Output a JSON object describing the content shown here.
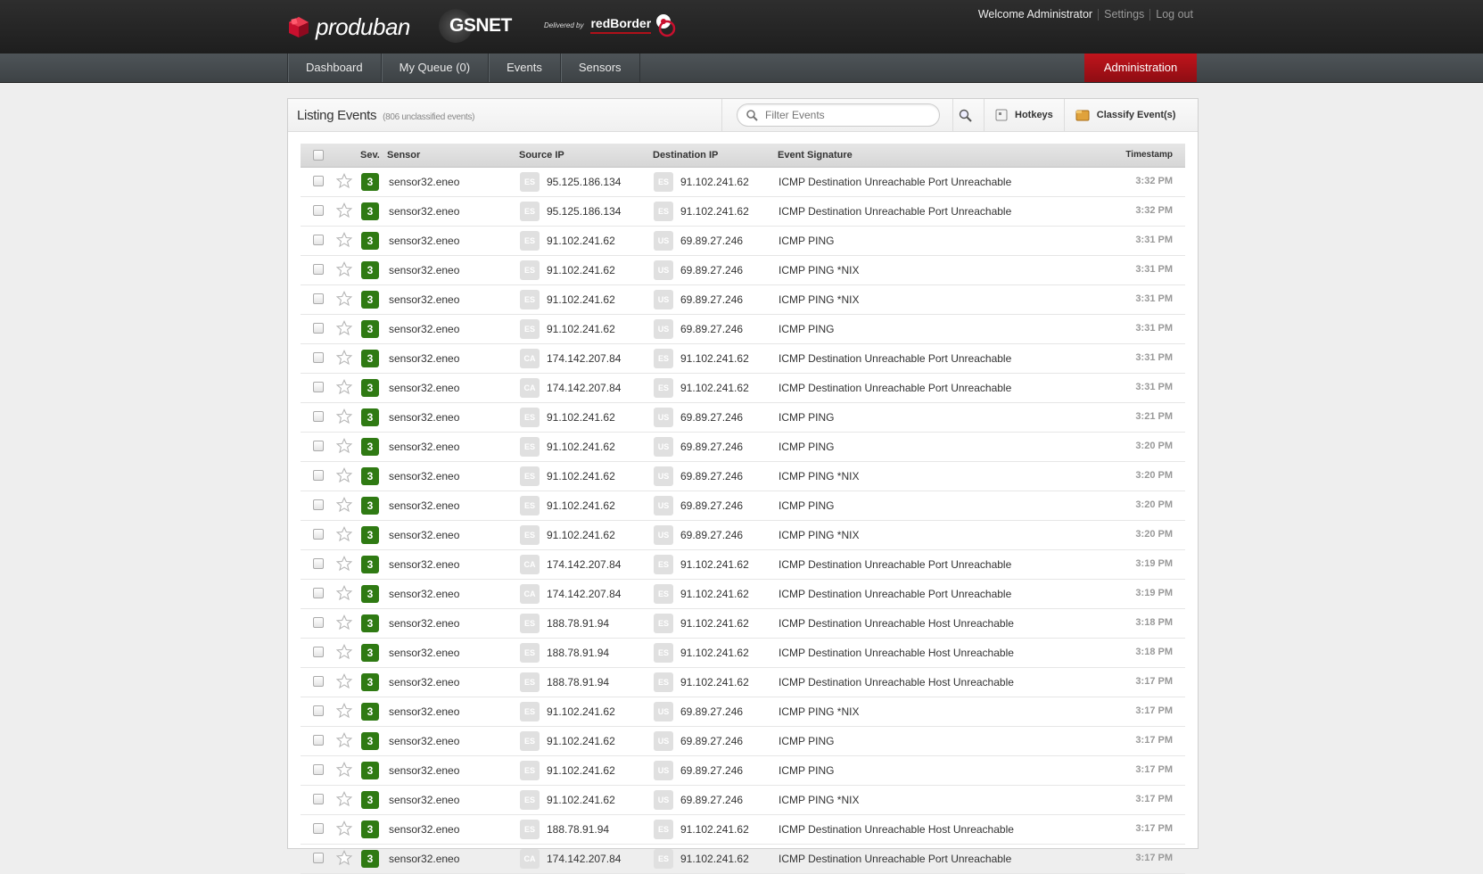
{
  "header": {
    "brand": "produban",
    "brand2": "GSNET",
    "delivered_by": "Delivered by",
    "redborder": "redBorder",
    "welcome": "Welcome Administrator",
    "settings": "Settings",
    "logout": "Log out"
  },
  "nav": {
    "tabs": [
      {
        "label": "Dashboard"
      },
      {
        "label": "My Queue (0)"
      },
      {
        "label": "Events"
      },
      {
        "label": "Sensors"
      }
    ],
    "admin": "Administration"
  },
  "panel": {
    "title": "Listing Events",
    "subtitle": "(806 unclassified events)",
    "filter_placeholder": "Filter Events",
    "hotkeys": "Hotkeys",
    "classify": "Classify Event(s)"
  },
  "columns": {
    "sev": "Sev.",
    "sensor": "Sensor",
    "source_ip": "Source IP",
    "destination_ip": "Destination IP",
    "signature": "Event Signature",
    "timestamp": "Timestamp"
  },
  "events": [
    {
      "sev": "3",
      "sensor": "sensor32.eneo",
      "src_cc": "ES",
      "src": "95.125.186.134",
      "dst_cc": "ES",
      "dst": "91.102.241.62",
      "sig": "ICMP Destination Unreachable Port Unreachable",
      "ts": "3:32 PM"
    },
    {
      "sev": "3",
      "sensor": "sensor32.eneo",
      "src_cc": "ES",
      "src": "95.125.186.134",
      "dst_cc": "ES",
      "dst": "91.102.241.62",
      "sig": "ICMP Destination Unreachable Port Unreachable",
      "ts": "3:32 PM"
    },
    {
      "sev": "3",
      "sensor": "sensor32.eneo",
      "src_cc": "ES",
      "src": "91.102.241.62",
      "dst_cc": "US",
      "dst": "69.89.27.246",
      "sig": "ICMP PING",
      "ts": "3:31 PM"
    },
    {
      "sev": "3",
      "sensor": "sensor32.eneo",
      "src_cc": "ES",
      "src": "91.102.241.62",
      "dst_cc": "US",
      "dst": "69.89.27.246",
      "sig": "ICMP PING *NIX",
      "ts": "3:31 PM"
    },
    {
      "sev": "3",
      "sensor": "sensor32.eneo",
      "src_cc": "ES",
      "src": "91.102.241.62",
      "dst_cc": "US",
      "dst": "69.89.27.246",
      "sig": "ICMP PING *NIX",
      "ts": "3:31 PM"
    },
    {
      "sev": "3",
      "sensor": "sensor32.eneo",
      "src_cc": "ES",
      "src": "91.102.241.62",
      "dst_cc": "US",
      "dst": "69.89.27.246",
      "sig": "ICMP PING",
      "ts": "3:31 PM"
    },
    {
      "sev": "3",
      "sensor": "sensor32.eneo",
      "src_cc": "CA",
      "src": "174.142.207.84",
      "dst_cc": "ES",
      "dst": "91.102.241.62",
      "sig": "ICMP Destination Unreachable Port Unreachable",
      "ts": "3:31 PM"
    },
    {
      "sev": "3",
      "sensor": "sensor32.eneo",
      "src_cc": "CA",
      "src": "174.142.207.84",
      "dst_cc": "ES",
      "dst": "91.102.241.62",
      "sig": "ICMP Destination Unreachable Port Unreachable",
      "ts": "3:31 PM"
    },
    {
      "sev": "3",
      "sensor": "sensor32.eneo",
      "src_cc": "ES",
      "src": "91.102.241.62",
      "dst_cc": "US",
      "dst": "69.89.27.246",
      "sig": "ICMP PING",
      "ts": "3:21 PM"
    },
    {
      "sev": "3",
      "sensor": "sensor32.eneo",
      "src_cc": "ES",
      "src": "91.102.241.62",
      "dst_cc": "US",
      "dst": "69.89.27.246",
      "sig": "ICMP PING",
      "ts": "3:20 PM"
    },
    {
      "sev": "3",
      "sensor": "sensor32.eneo",
      "src_cc": "ES",
      "src": "91.102.241.62",
      "dst_cc": "US",
      "dst": "69.89.27.246",
      "sig": "ICMP PING *NIX",
      "ts": "3:20 PM"
    },
    {
      "sev": "3",
      "sensor": "sensor32.eneo",
      "src_cc": "ES",
      "src": "91.102.241.62",
      "dst_cc": "US",
      "dst": "69.89.27.246",
      "sig": "ICMP PING",
      "ts": "3:20 PM"
    },
    {
      "sev": "3",
      "sensor": "sensor32.eneo",
      "src_cc": "ES",
      "src": "91.102.241.62",
      "dst_cc": "US",
      "dst": "69.89.27.246",
      "sig": "ICMP PING *NIX",
      "ts": "3:20 PM"
    },
    {
      "sev": "3",
      "sensor": "sensor32.eneo",
      "src_cc": "CA",
      "src": "174.142.207.84",
      "dst_cc": "ES",
      "dst": "91.102.241.62",
      "sig": "ICMP Destination Unreachable Port Unreachable",
      "ts": "3:19 PM"
    },
    {
      "sev": "3",
      "sensor": "sensor32.eneo",
      "src_cc": "CA",
      "src": "174.142.207.84",
      "dst_cc": "ES",
      "dst": "91.102.241.62",
      "sig": "ICMP Destination Unreachable Port Unreachable",
      "ts": "3:19 PM"
    },
    {
      "sev": "3",
      "sensor": "sensor32.eneo",
      "src_cc": "ES",
      "src": "188.78.91.94",
      "dst_cc": "ES",
      "dst": "91.102.241.62",
      "sig": "ICMP Destination Unreachable Host Unreachable",
      "ts": "3:18 PM"
    },
    {
      "sev": "3",
      "sensor": "sensor32.eneo",
      "src_cc": "ES",
      "src": "188.78.91.94",
      "dst_cc": "ES",
      "dst": "91.102.241.62",
      "sig": "ICMP Destination Unreachable Host Unreachable",
      "ts": "3:18 PM"
    },
    {
      "sev": "3",
      "sensor": "sensor32.eneo",
      "src_cc": "ES",
      "src": "188.78.91.94",
      "dst_cc": "ES",
      "dst": "91.102.241.62",
      "sig": "ICMP Destination Unreachable Host Unreachable",
      "ts": "3:17 PM"
    },
    {
      "sev": "3",
      "sensor": "sensor32.eneo",
      "src_cc": "ES",
      "src": "91.102.241.62",
      "dst_cc": "US",
      "dst": "69.89.27.246",
      "sig": "ICMP PING *NIX",
      "ts": "3:17 PM"
    },
    {
      "sev": "3",
      "sensor": "sensor32.eneo",
      "src_cc": "ES",
      "src": "91.102.241.62",
      "dst_cc": "US",
      "dst": "69.89.27.246",
      "sig": "ICMP PING",
      "ts": "3:17 PM"
    },
    {
      "sev": "3",
      "sensor": "sensor32.eneo",
      "src_cc": "ES",
      "src": "91.102.241.62",
      "dst_cc": "US",
      "dst": "69.89.27.246",
      "sig": "ICMP PING",
      "ts": "3:17 PM"
    },
    {
      "sev": "3",
      "sensor": "sensor32.eneo",
      "src_cc": "ES",
      "src": "91.102.241.62",
      "dst_cc": "US",
      "dst": "69.89.27.246",
      "sig": "ICMP PING *NIX",
      "ts": "3:17 PM"
    },
    {
      "sev": "3",
      "sensor": "sensor32.eneo",
      "src_cc": "ES",
      "src": "188.78.91.94",
      "dst_cc": "ES",
      "dst": "91.102.241.62",
      "sig": "ICMP Destination Unreachable Host Unreachable",
      "ts": "3:17 PM"
    },
    {
      "sev": "3",
      "sensor": "sensor32.eneo",
      "src_cc": "CA",
      "src": "174.142.207.84",
      "dst_cc": "ES",
      "dst": "91.102.241.62",
      "sig": "ICMP Destination Unreachable Port Unreachable",
      "ts": "3:17 PM"
    }
  ]
}
